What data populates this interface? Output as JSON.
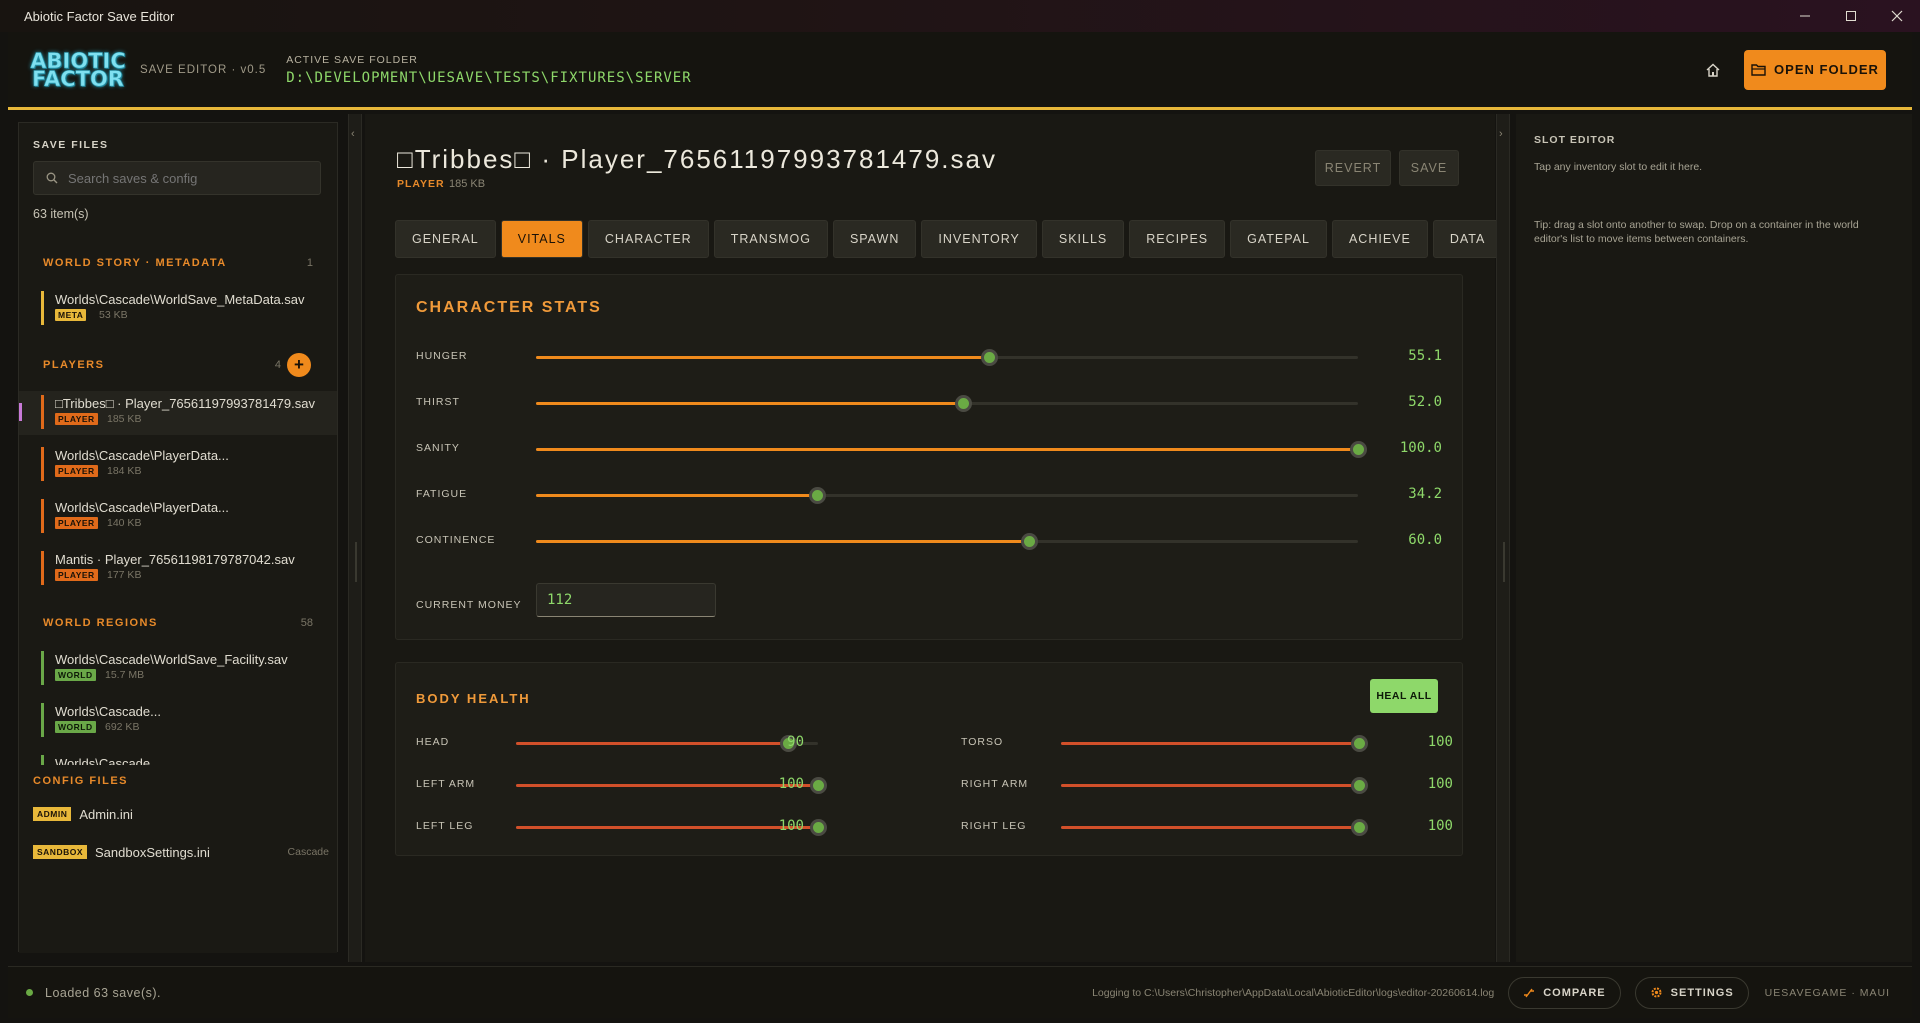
{
  "window": {
    "title": "Abiotic Factor Save Editor"
  },
  "header": {
    "logo_line1": "ABIOTIC",
    "logo_line2": "FACTOR",
    "version": "SAVE EDITOR · v0.5",
    "folder_label": "ACTIVE SAVE FOLDER",
    "folder_path": "D:\\DEVELOPMENT\\UESAVE\\TESTS\\FIXTURES\\SERVER",
    "open_folder_label": "OPEN FOLDER"
  },
  "sidebar": {
    "heading": "SAVE FILES",
    "search_placeholder": "Search saves & config",
    "item_count": "63 item(s)",
    "sections": {
      "metadata": {
        "label": "WORLD STORY · METADATA",
        "count": "1"
      },
      "players": {
        "label": "PLAYERS",
        "count": "4"
      },
      "regions": {
        "label": "WORLD REGIONS",
        "count": "58"
      }
    },
    "metadata_items": [
      {
        "name": "Worlds\\Cascade\\WorldSave_MetaData.sav",
        "tag": "META",
        "size": "53 KB"
      }
    ],
    "player_items": [
      {
        "name": "□Tribbes□ · Player_76561197993781479.sav",
        "tag": "PLAYER",
        "size": "185 KB"
      },
      {
        "name": "Worlds\\Cascade\\PlayerData...",
        "tag": "PLAYER",
        "size": "184 KB"
      },
      {
        "name": "Worlds\\Cascade\\PlayerData...",
        "tag": "PLAYER",
        "size": "140 KB"
      },
      {
        "name": "Mantis · Player_76561198179787042.sav",
        "tag": "PLAYER",
        "size": "177 KB"
      }
    ],
    "region_items": [
      {
        "name": "Worlds\\Cascade\\WorldSave_Facility.sav",
        "tag": "WORLD",
        "size": "15.7 MB"
      },
      {
        "name": "Worlds\\Cascade...",
        "tag": "WORLD",
        "size": "692 KB"
      },
      {
        "name": "Worlds\\Cascade..."
      }
    ],
    "config_heading": "CONFIG FILES",
    "config_items": [
      {
        "tag": "ADMIN",
        "name": "Admin.ini",
        "extra": ""
      },
      {
        "tag": "SANDBOX",
        "name": "SandboxSettings.ini",
        "extra": "Cascade"
      }
    ]
  },
  "main": {
    "file_title": "□Tribbes□  ·  Player_76561197993781479.sav",
    "file_type": "PLAYER",
    "file_size": "185 KB",
    "revert_label": "REVERT",
    "save_label": "SAVE",
    "tabs": [
      "GENERAL",
      "VITALS",
      "CHARACTER",
      "TRANSMOG",
      "SPAWN",
      "INVENTORY",
      "SKILLS",
      "RECIPES",
      "GATEPAL",
      "ACHIEVE",
      "DATA"
    ],
    "active_tab": "VITALS",
    "character_stats": {
      "title": "CHARACTER STATS",
      "stats": [
        {
          "label": "HUNGER",
          "value": 55.1,
          "display": "55.1"
        },
        {
          "label": "THIRST",
          "value": 52.0,
          "display": "52.0"
        },
        {
          "label": "SANITY",
          "value": 100.0,
          "display": "100.0"
        },
        {
          "label": "FATIGUE",
          "value": 34.2,
          "display": "34.2"
        },
        {
          "label": "CONTINENCE",
          "value": 60.0,
          "display": "60.0"
        }
      ],
      "money_label": "CURRENT MONEY",
      "money_value": "112"
    },
    "body_health": {
      "title": "BODY HEALTH",
      "heal_label": "HEAL ALL",
      "left": [
        {
          "label": "HEAD",
          "value": 90,
          "display": "90"
        },
        {
          "label": "LEFT ARM",
          "value": 100,
          "display": "100"
        },
        {
          "label": "LEFT LEG",
          "value": 100,
          "display": "100"
        }
      ],
      "right": [
        {
          "label": "TORSO",
          "value": 100,
          "display": "100"
        },
        {
          "label": "RIGHT ARM",
          "value": 100,
          "display": "100"
        },
        {
          "label": "RIGHT LEG",
          "value": 100,
          "display": "100"
        }
      ]
    }
  },
  "slot_editor": {
    "heading": "SLOT EDITOR",
    "hint": "Tap any inventory slot to edit it here.",
    "tip": "Tip: drag a slot onto another to swap. Drop on a container in the world editor's list to move items between containers."
  },
  "statusbar": {
    "status": "Loaded 63 save(s).",
    "log": "Logging to C:\\Users\\Christopher\\AppData\\Local\\AbioticEditor\\logs\\editor-20260614.log",
    "compare_label": "COMPARE",
    "settings_label": "SETTINGS",
    "brand": "UESAVEGAME · MAUI"
  },
  "colors": {
    "accent": "#f08a1c",
    "good": "#8ed86a",
    "health": "#d2502a",
    "meta": "#e8b83a",
    "world": "#6aa848"
  }
}
